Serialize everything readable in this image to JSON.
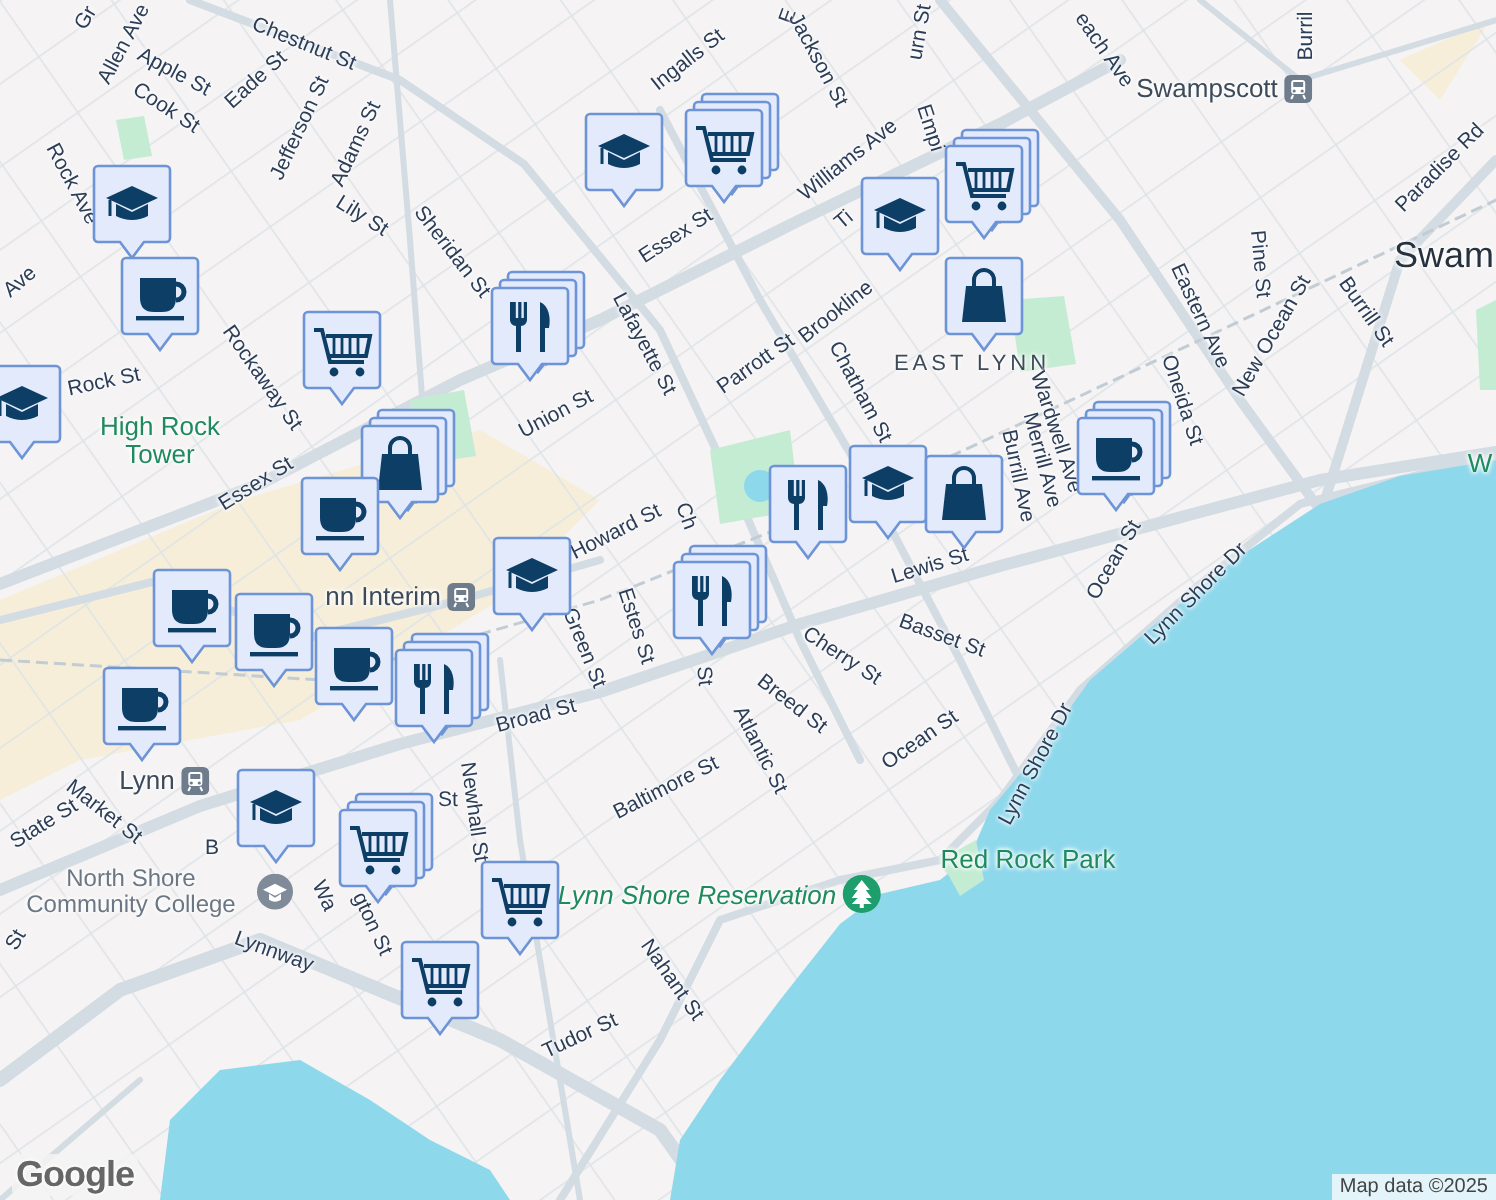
{
  "labels": [
    {
      "text": "Gr",
      "kind": "street"
    },
    {
      "text": "Allen Ave",
      "kind": "street"
    },
    {
      "text": "Chestnut St",
      "kind": "street"
    },
    {
      "text": "Apple St",
      "kind": "street"
    },
    {
      "text": "Eade St",
      "kind": "street"
    },
    {
      "text": "Cook St",
      "kind": "street"
    },
    {
      "text": "Jefferson St",
      "kind": "street"
    },
    {
      "text": "Adams St",
      "kind": "street"
    },
    {
      "text": "Rock Ave",
      "kind": "street"
    },
    {
      "text": "Lily St",
      "kind": "street"
    },
    {
      "text": "Sheridan St",
      "kind": "street"
    },
    {
      "text": "Ave",
      "kind": "street"
    },
    {
      "text": "Rock St",
      "kind": "street"
    },
    {
      "text": "High Rock Tower",
      "kind": "park"
    },
    {
      "text": "Rockaway St",
      "kind": "street"
    },
    {
      "text": "Essex St",
      "kind": "street"
    },
    {
      "text": "Ingalls St",
      "kind": "street"
    },
    {
      "text": "Essex St",
      "kind": "street"
    },
    {
      "text": "Lafayette St",
      "kind": "street"
    },
    {
      "text": "Union St",
      "kind": "street"
    },
    {
      "text": "Parrott St",
      "kind": "street"
    },
    {
      "text": "Howard St",
      "kind": "street"
    },
    {
      "text": "E",
      "kind": "street"
    },
    {
      "text": "Jackson St",
      "kind": "street"
    },
    {
      "text": "urn St",
      "kind": "street"
    },
    {
      "text": "each Ave",
      "kind": "street"
    },
    {
      "text": "Burril",
      "kind": "street"
    },
    {
      "text": "Swampscott",
      "kind": "station"
    },
    {
      "text": "Williams Ave",
      "kind": "street"
    },
    {
      "text": "Empi",
      "kind": "street"
    },
    {
      "text": "Ti",
      "kind": "street"
    },
    {
      "text": "Brookline",
      "kind": "street"
    },
    {
      "text": "EAST LYNN",
      "kind": "district"
    },
    {
      "text": "Eastern Ave",
      "kind": "street"
    },
    {
      "text": "Pine St",
      "kind": "street"
    },
    {
      "text": "New Ocean St",
      "kind": "street"
    },
    {
      "text": "Burrill St",
      "kind": "street"
    },
    {
      "text": "Paradise Rd",
      "kind": "street"
    },
    {
      "text": "Swam",
      "kind": "town"
    },
    {
      "text": "Oneida St",
      "kind": "street"
    },
    {
      "text": "Wardwell Ave",
      "kind": "street"
    },
    {
      "text": "Merrill Ave",
      "kind": "street"
    },
    {
      "text": "Burrill Ave",
      "kind": "street"
    },
    {
      "text": "Chatham St",
      "kind": "street"
    },
    {
      "text": "Lewis St",
      "kind": "street"
    },
    {
      "text": "Ocean St",
      "kind": "street"
    },
    {
      "text": "Lynn Shore Dr",
      "kind": "street"
    },
    {
      "text": "W",
      "kind": "park"
    },
    {
      "text": "Ch",
      "kind": "street"
    },
    {
      "text": "St",
      "kind": "street"
    },
    {
      "text": "Estes St",
      "kind": "street"
    },
    {
      "text": "Green St",
      "kind": "street"
    },
    {
      "text": "Basset St",
      "kind": "street"
    },
    {
      "text": "Cherry St",
      "kind": "street"
    },
    {
      "text": "Breed St",
      "kind": "street"
    },
    {
      "text": "Atlantic St",
      "kind": "street"
    },
    {
      "text": "Ocean St",
      "kind": "street"
    },
    {
      "text": "Baltimore St",
      "kind": "street"
    },
    {
      "text": "nn Interim",
      "kind": "station"
    },
    {
      "text": "Broad St",
      "kind": "street"
    },
    {
      "text": "Lynn",
      "kind": "station"
    },
    {
      "text": "Market St",
      "kind": "street"
    },
    {
      "text": "State St",
      "kind": "street"
    },
    {
      "text": "B",
      "kind": "street"
    },
    {
      "text": "St",
      "kind": "street"
    },
    {
      "text": "Newhall St",
      "kind": "street"
    },
    {
      "text": "Wa",
      "kind": "street"
    },
    {
      "text": "gton St",
      "kind": "street"
    },
    {
      "text": "North Shore Community College",
      "kind": "college"
    },
    {
      "text": "Lynn Shore Reservation",
      "kind": "reserve"
    },
    {
      "text": "Red Rock Park",
      "kind": "park"
    },
    {
      "text": "Lynnway",
      "kind": "street"
    },
    {
      "text": "Nahant St",
      "kind": "street"
    },
    {
      "text": "Tudor St",
      "kind": "street"
    },
    {
      "text": "St",
      "kind": "street"
    },
    {
      "text": "Lynn Shore Dr",
      "kind": "street"
    }
  ],
  "markers": [
    {
      "kind": "school",
      "stacked": false
    },
    {
      "kind": "cafe",
      "stacked": false
    },
    {
      "kind": "school",
      "stacked": false
    },
    {
      "kind": "grocery",
      "stacked": false
    },
    {
      "kind": "shopping",
      "stacked": true
    },
    {
      "kind": "cafe",
      "stacked": false
    },
    {
      "kind": "restaurant",
      "stacked": true
    },
    {
      "kind": "school",
      "stacked": false
    },
    {
      "kind": "grocery",
      "stacked": true
    },
    {
      "kind": "school",
      "stacked": false
    },
    {
      "kind": "grocery",
      "stacked": true
    },
    {
      "kind": "shopping",
      "stacked": false
    },
    {
      "kind": "cafe",
      "stacked": true
    },
    {
      "kind": "restaurant",
      "stacked": false
    },
    {
      "kind": "school",
      "stacked": false
    },
    {
      "kind": "shopping",
      "stacked": false
    },
    {
      "kind": "restaurant",
      "stacked": true
    },
    {
      "kind": "school",
      "stacked": false
    },
    {
      "kind": "cafe",
      "stacked": false
    },
    {
      "kind": "cafe",
      "stacked": false
    },
    {
      "kind": "cafe",
      "stacked": false
    },
    {
      "kind": "restaurant",
      "stacked": true
    },
    {
      "kind": "cafe",
      "stacked": false
    },
    {
      "kind": "school",
      "stacked": false
    },
    {
      "kind": "grocery",
      "stacked": true
    },
    {
      "kind": "grocery",
      "stacked": false
    },
    {
      "kind": "grocery",
      "stacked": false
    }
  ],
  "logo": "Google",
  "attribution": "Map data ©2025"
}
